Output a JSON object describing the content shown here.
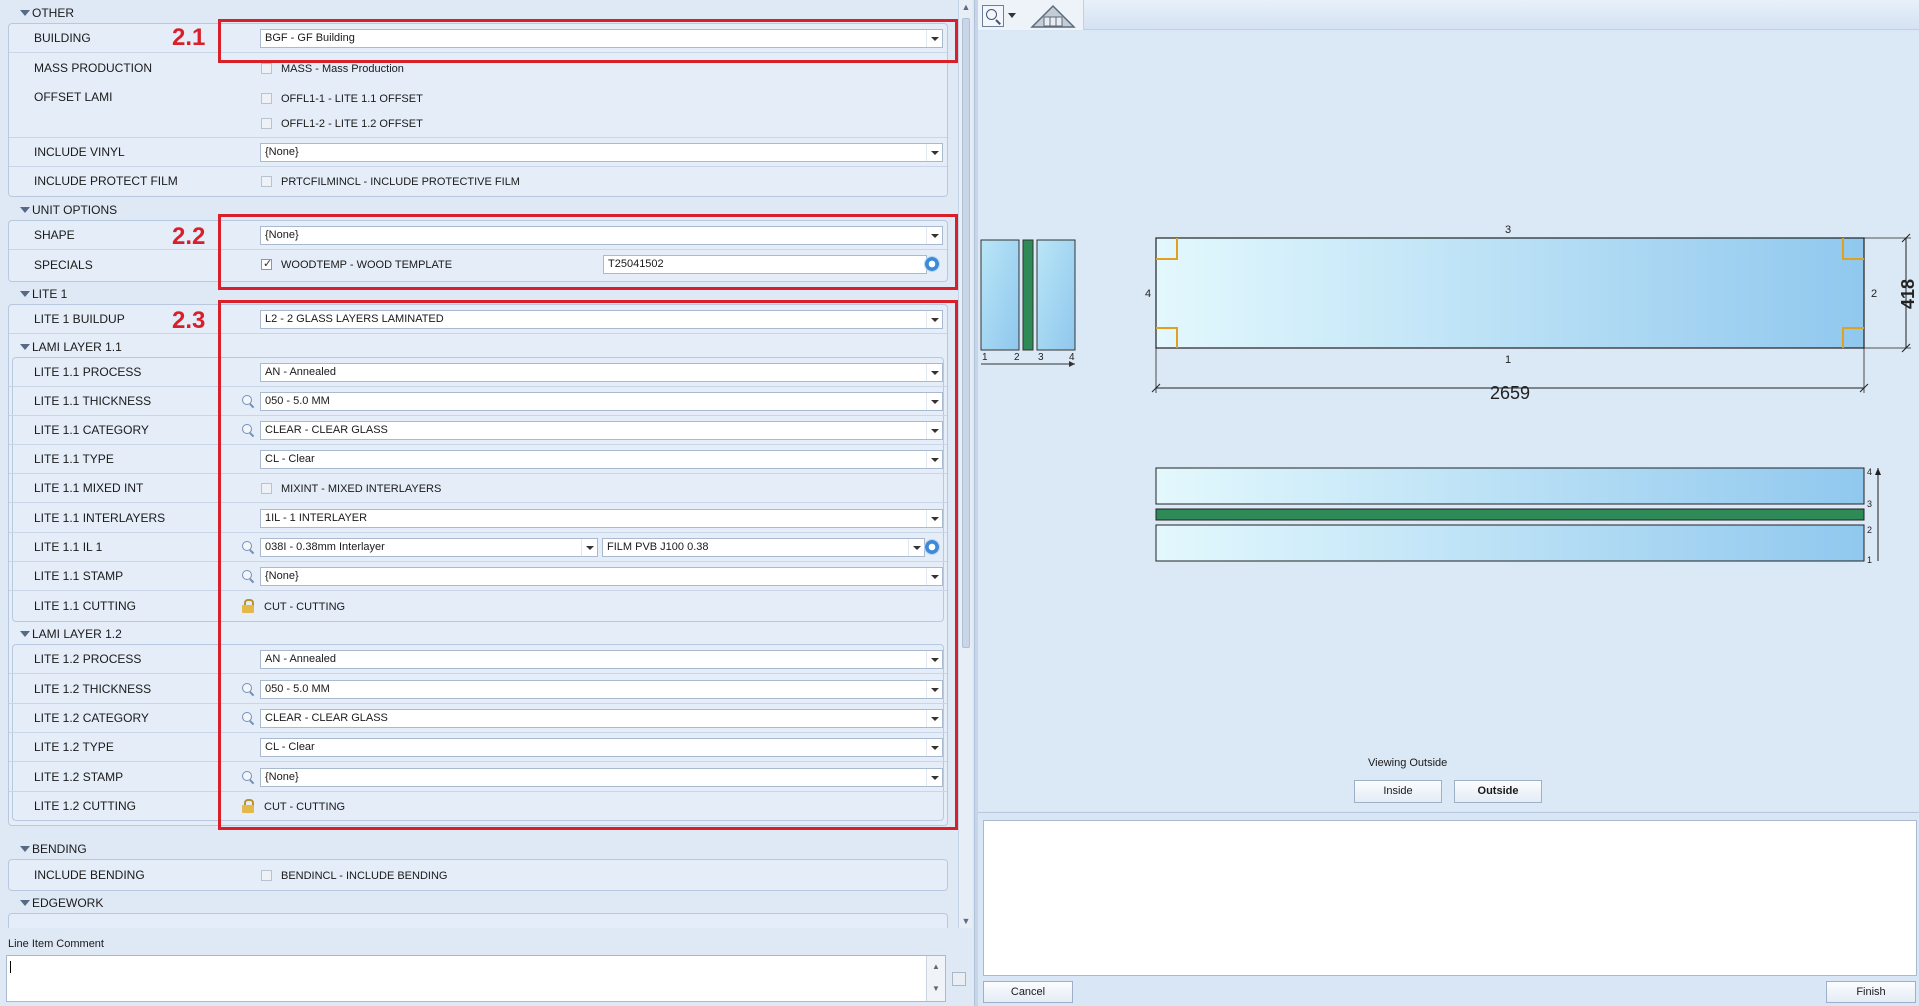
{
  "sections": {
    "other": "OTHER",
    "unit_options": "UNIT OPTIONS",
    "lite1": "LITE 1",
    "lami11": "LAMI LAYER 1.1",
    "lami12": "LAMI LAYER 1.2",
    "bending": "BENDING",
    "edgework": "EDGEWORK"
  },
  "rows": {
    "building": {
      "label": "BUILDING",
      "value": "BGF - GF Building"
    },
    "mass_production": {
      "label": "MASS PRODUCTION",
      "option": "MASS - Mass Production"
    },
    "offset_lami": {
      "label": "OFFSET LAMI",
      "option1": "OFFL1-1 - LITE 1.1 OFFSET",
      "option2": "OFFL1-2 - LITE 1.2 OFFSET"
    },
    "include_vinyl": {
      "label": "INCLUDE VINYL",
      "value": "{None}"
    },
    "include_protect_film": {
      "label": "INCLUDE PROTECT FILM",
      "option": "PRTCFILMINCL - INCLUDE PROTECTIVE FILM"
    },
    "shape": {
      "label": "SHAPE",
      "value": "{None}"
    },
    "specials": {
      "label": "SPECIALS",
      "option": "WOODTEMP - WOOD TEMPLATE",
      "text": "T25041502"
    },
    "lite1_buildup": {
      "label": "LITE 1 BUILDUP",
      "value": "L2 - 2 GLASS LAYERS LAMINATED"
    },
    "l11_process": {
      "label": "LITE 1.1 PROCESS",
      "value": "AN - Annealed"
    },
    "l11_thickness": {
      "label": "LITE 1.1 THICKNESS",
      "value": "050 - 5.0 MM"
    },
    "l11_category": {
      "label": "LITE 1.1 CATEGORY",
      "value": "CLEAR - CLEAR GLASS"
    },
    "l11_type": {
      "label": "LITE 1.1 TYPE",
      "value": "CL - Clear"
    },
    "l11_mixed": {
      "label": "LITE 1.1 MIXED INT",
      "option": "MIXINT - MIXED INTERLAYERS"
    },
    "l11_interlayers": {
      "label": "LITE 1.1 INTERLAYERS",
      "value": "1IL - 1 INTERLAYER"
    },
    "l11_il1": {
      "label": "LITE 1.1 IL 1",
      "value": "038I - 0.38mm Interlayer",
      "value2": "FILM PVB J100 0.38"
    },
    "l11_stamp": {
      "label": "LITE 1.1 STAMP",
      "value": "{None}"
    },
    "l11_cutting": {
      "label": "LITE 1.1 CUTTING",
      "value": "CUT - CUTTING"
    },
    "l12_process": {
      "label": "LITE 1.2 PROCESS",
      "value": "AN - Annealed"
    },
    "l12_thickness": {
      "label": "LITE 1.2 THICKNESS",
      "value": "050 - 5.0 MM"
    },
    "l12_category": {
      "label": "LITE 1.2 CATEGORY",
      "value": "CLEAR - CLEAR GLASS"
    },
    "l12_type": {
      "label": "LITE 1.2 TYPE",
      "value": "CL - Clear"
    },
    "l12_stamp": {
      "label": "LITE 1.2 STAMP",
      "value": "{None}"
    },
    "l12_cutting": {
      "label": "LITE 1.2 CUTTING",
      "value": "CUT - CUTTING"
    },
    "include_bending": {
      "label": "INCLUDE BENDING",
      "option": "BENDINCL - INCLUDE BENDING"
    }
  },
  "annotations": {
    "a1": "2.1",
    "a2": "2.2",
    "a3": "2.3"
  },
  "comment": {
    "label": "Line Item Comment",
    "value": ""
  },
  "drawing": {
    "edge_top": "3",
    "edge_bottom": "1",
    "edge_left": "4",
    "edge_right": "2",
    "width": "2659",
    "height": "418",
    "layers_small": [
      "1",
      "2",
      "3",
      "4"
    ],
    "layers_side": [
      "4",
      "3",
      "2",
      "1"
    ]
  },
  "viewer": {
    "viewing_label": "Viewing Outside",
    "inside": "Inside",
    "outside": "Outside"
  },
  "footer": {
    "cancel": "Cancel",
    "finish": "Finish"
  },
  "colors": {
    "annotation_red": "#d9202a",
    "interlayer_green": "#2e8b57",
    "glass_blue": "#9fd4f0"
  }
}
